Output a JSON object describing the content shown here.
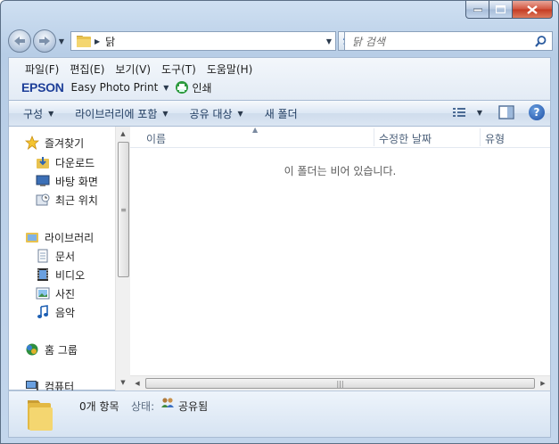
{
  "window": {
    "title": "닭"
  },
  "address": {
    "path": "닭"
  },
  "search": {
    "placeholder": "닭 검색"
  },
  "menu": {
    "items": [
      "파일(F)",
      "편집(E)",
      "보기(V)",
      "도구(T)",
      "도움말(H)"
    ]
  },
  "epson": {
    "logo": "EPSON",
    "app": "Easy Photo Print",
    "print_label": "인쇄"
  },
  "commands": {
    "organize": "구성",
    "include_library": "라이브러리에 포함",
    "share_with": "공유 대상",
    "new_folder": "새 폴더"
  },
  "nav": {
    "favorites": "즐겨찾기",
    "favorites_items": [
      "다운로드",
      "바탕 화면",
      "최근 위치"
    ],
    "libraries": "라이브러리",
    "libraries_items": [
      "문서",
      "비디오",
      "사진",
      "음악"
    ],
    "homegroup": "홈 그룹",
    "computer": "컴퓨터"
  },
  "columns": {
    "name": "이름",
    "modified": "수정한 날짜",
    "type": "유형"
  },
  "content": {
    "empty_message": "이 폴더는 비어 있습니다."
  },
  "details": {
    "item_count": "0개 항목",
    "state_label": "상태:",
    "state_value": "공유됨"
  },
  "colors": {
    "accent": "#1e3f99",
    "help": "#1d4fa6",
    "close": "#c43b22"
  }
}
